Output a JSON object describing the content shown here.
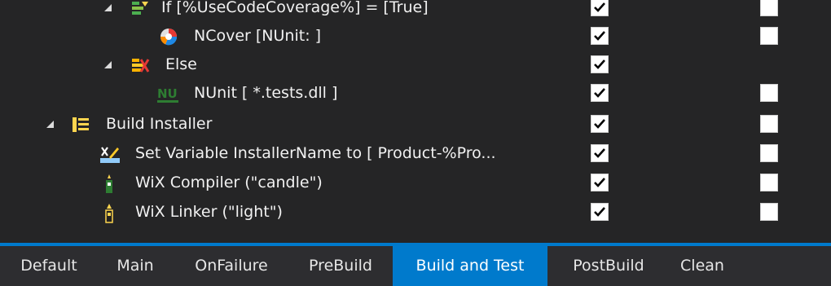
{
  "rows": [
    {
      "label": "If [%UseCodeCoverage%] = [True]",
      "icon": "if-condition-icon",
      "checked1": true,
      "checked2": false
    },
    {
      "label": "NCover [NUnit: ]",
      "icon": "ncover-icon",
      "checked1": true,
      "checked2": false
    },
    {
      "label": "Else",
      "icon": "else-icon",
      "checked1": true,
      "checked2": null
    },
    {
      "label": "NUnit [ *.tests.dll ]",
      "icon": "nunit-icon",
      "icon_text": "NU",
      "checked1": true,
      "checked2": false
    },
    {
      "label": "Build Installer",
      "icon": "group-icon",
      "checked1": true,
      "checked2": false
    },
    {
      "label": "Set Variable InstallerName to [ Product-%Pro...",
      "icon": "set-variable-icon",
      "checked1": true,
      "checked2": false
    },
    {
      "label": "WiX Compiler (\"candle\")",
      "icon": "wix-candle-icon",
      "checked1": true,
      "checked2": false
    },
    {
      "label": "WiX Linker (\"light\")",
      "icon": "wix-light-icon",
      "checked1": true,
      "checked2": false
    }
  ],
  "tabs": [
    {
      "label": "Default",
      "active": false
    },
    {
      "label": "Main",
      "active": false
    },
    {
      "label": "OnFailure",
      "active": false
    },
    {
      "label": "PreBuild",
      "active": false
    },
    {
      "label": "Build and Test",
      "active": true
    },
    {
      "label": "PostBuild",
      "active": false
    },
    {
      "label": "Clean",
      "active": false
    }
  ],
  "colors": {
    "background": "#252526",
    "accent": "#007acc",
    "tab_bar": "#2d2d30",
    "text": "#f1f1f1"
  }
}
